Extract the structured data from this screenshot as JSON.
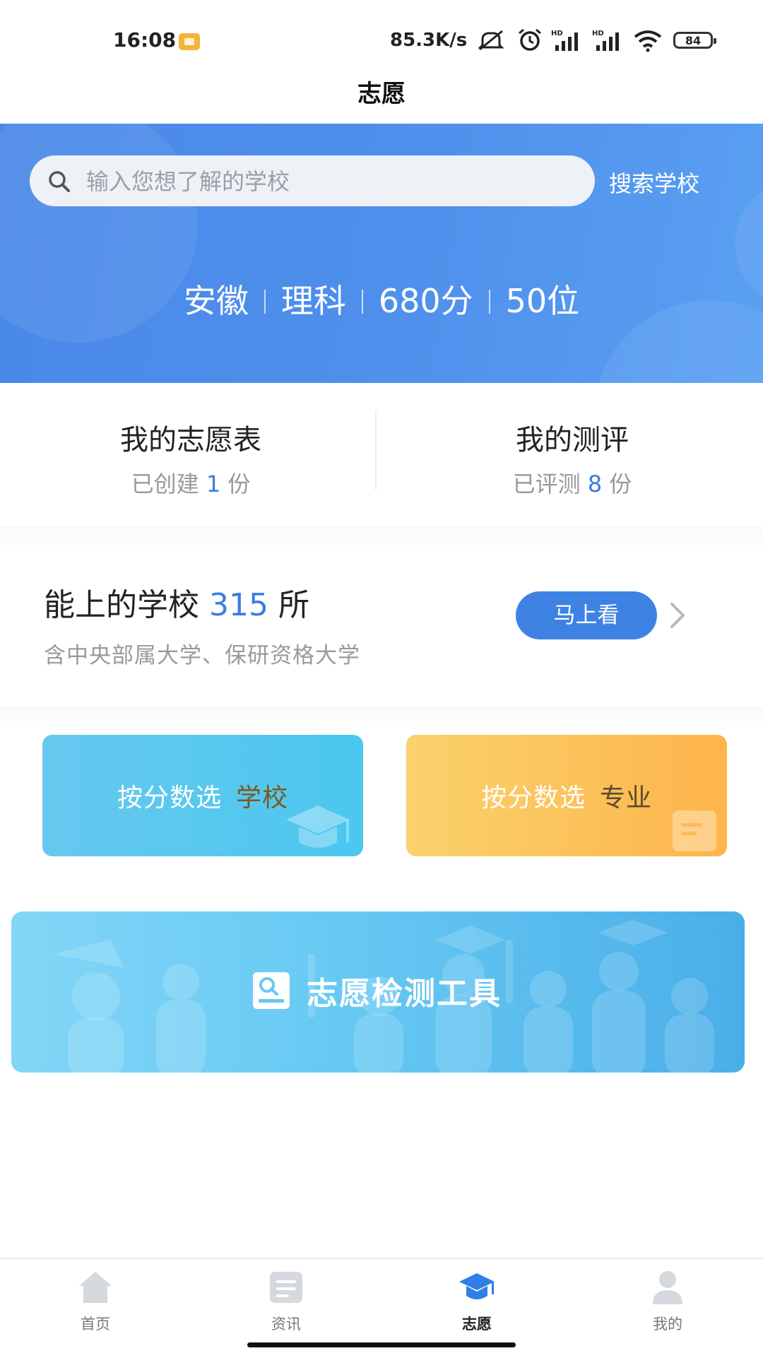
{
  "status_bar": {
    "time": "16:08",
    "net_speed": "85.3K/s",
    "battery": "84"
  },
  "page_title": "志愿",
  "search": {
    "placeholder": "输入您想了解的学校",
    "button_label": "搜索学校"
  },
  "profile": {
    "province": "安徽",
    "subject": "理科",
    "score": "680分",
    "rank": "50位"
  },
  "stats": {
    "my_form": {
      "title": "我的志愿表",
      "prefix": "已创建",
      "count": "1",
      "suffix": "份"
    },
    "my_eval": {
      "title": "我的测评",
      "prefix": "已评测",
      "count": "8",
      "suffix": "份"
    }
  },
  "reachable": {
    "title_prefix": "能上的学校",
    "count": "315",
    "title_suffix": "所",
    "subtitle": "含中央部属大学、保研资格大学",
    "button_label": "马上看"
  },
  "select_cards": {
    "school": {
      "label": "按分数选",
      "accent": "学校"
    },
    "major": {
      "label": "按分数选",
      "accent": "专业"
    }
  },
  "detect_tool": {
    "label": "志愿检测工具"
  },
  "bottom_nav": {
    "items": [
      {
        "label": "首页",
        "icon": "home-icon"
      },
      {
        "label": "资讯",
        "icon": "news-icon"
      },
      {
        "label": "志愿",
        "icon": "graduation-cap-icon",
        "active": true
      },
      {
        "label": "我的",
        "icon": "user-icon"
      }
    ]
  },
  "colors": {
    "primary": "#3e82e4",
    "banner_blue": "#4f90ec",
    "card_school": "#4bc7ef",
    "card_major": "#fdb44b",
    "detect_banner": "#66c9f3"
  }
}
